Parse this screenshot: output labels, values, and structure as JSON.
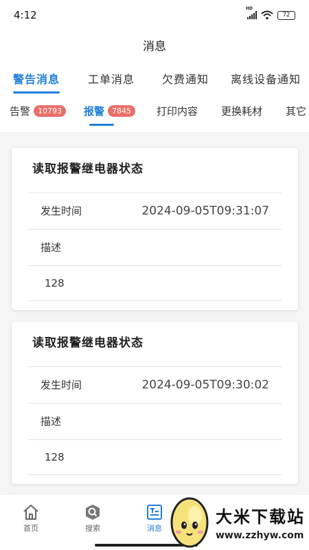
{
  "status_bar": {
    "time": "4:12",
    "battery": "72"
  },
  "header": {
    "title": "消息"
  },
  "primary_tabs": [
    {
      "label": "警告消息",
      "active": true
    },
    {
      "label": "工单消息",
      "active": false
    },
    {
      "label": "欠费通知",
      "active": false
    },
    {
      "label": "离线设备通知",
      "active": false
    }
  ],
  "secondary_tabs": [
    {
      "label": "告警",
      "badge": "10793",
      "active": false
    },
    {
      "label": "报警",
      "badge": "7845",
      "active": true
    },
    {
      "label": "打印内容",
      "active": false
    },
    {
      "label": "更换耗材",
      "active": false
    },
    {
      "label": "其它",
      "active": false
    }
  ],
  "cards": [
    {
      "title": "读取报警继电器状态",
      "time_label": "发生时间",
      "time_value": "2024-09-05T09:31:07",
      "desc_label": "描述",
      "desc_value": "128"
    },
    {
      "title": "读取报警继电器状态",
      "time_label": "发生时间",
      "time_value": "2024-09-05T09:30:02",
      "desc_label": "描述",
      "desc_value": "128"
    }
  ],
  "bottom_nav": [
    {
      "label": "首页",
      "icon": "home-icon",
      "active": false
    },
    {
      "label": "搜索",
      "icon": "search-icon",
      "active": false
    },
    {
      "label": "消息",
      "icon": "message-icon",
      "active": true
    }
  ],
  "watermark": {
    "title": "大米下载站",
    "url": "www.zzhyw.com"
  },
  "colors": {
    "accent": "#1f7fd6",
    "badge": "#ea6f6a",
    "background": "#f5f5f5"
  }
}
